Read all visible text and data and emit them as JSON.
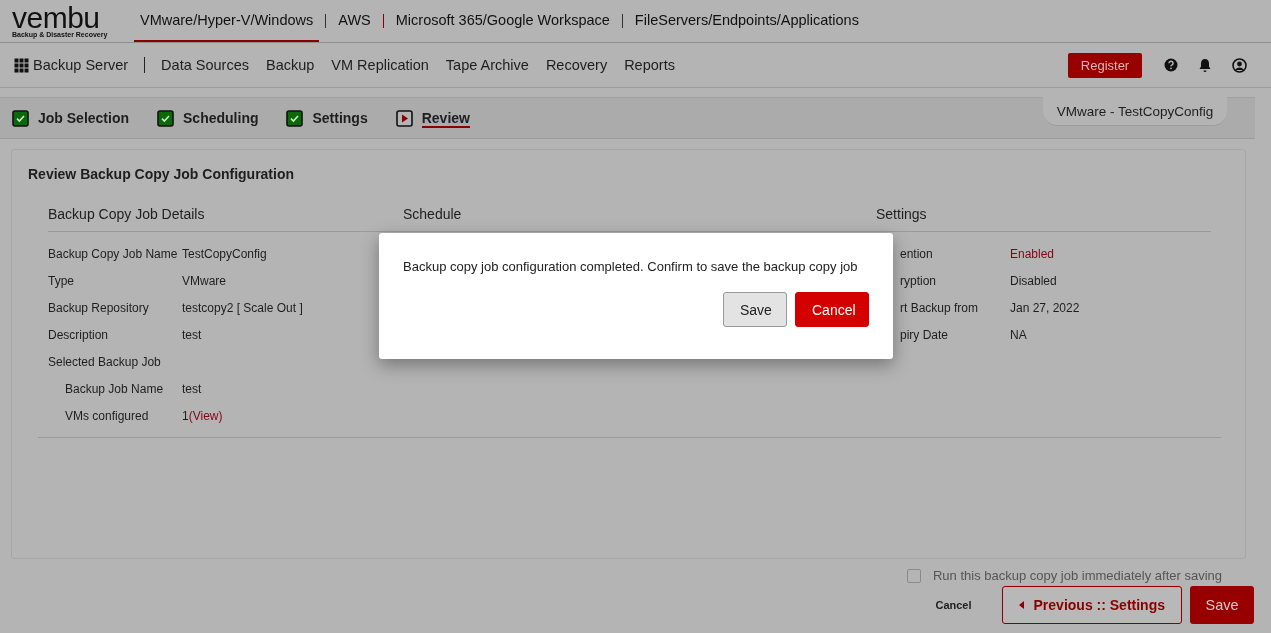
{
  "logo": {
    "name": "vembu",
    "tagline": "Backup & Disaster Recovery"
  },
  "product_tabs": [
    {
      "label": "VMware/Hyper-V/Windows",
      "selected": true
    },
    {
      "label": "AWS",
      "selected": false
    },
    {
      "label": "Microsoft 365/Google Workspace",
      "selected": false
    },
    {
      "label": "FileServers/Endpoints/Applications",
      "selected": false
    }
  ],
  "nav": {
    "home": "Backup Server",
    "items": [
      "Data Sources",
      "Backup",
      "VM Replication",
      "Tape Archive",
      "Recovery",
      "Reports"
    ]
  },
  "register_button": "Register",
  "wizard_steps": [
    {
      "label": "Job Selection",
      "kind": "done",
      "selected": false
    },
    {
      "label": "Scheduling",
      "kind": "done",
      "selected": false
    },
    {
      "label": "Settings",
      "kind": "done",
      "selected": false
    },
    {
      "label": "Review",
      "kind": "current",
      "selected": true
    }
  ],
  "job_title": "VMware - TestCopyConfig",
  "review": {
    "title": "Review Backup Copy Job Configuration",
    "details": {
      "heading": "Backup Copy Job Details",
      "rows": [
        {
          "label": "Backup Copy Job Name",
          "value": "TestCopyConfig"
        },
        {
          "label": "Type",
          "value": "VMware"
        },
        {
          "label": "Backup Repository",
          "value": "testcopy2 [ Scale Out ]"
        },
        {
          "label": "Description",
          "value": "test"
        }
      ],
      "selected_job": {
        "label": "Selected Backup Job",
        "rows": [
          {
            "label": "Backup Job Name",
            "value": "test"
          },
          {
            "label": "VMs configured",
            "value": "1",
            "link": "(View)"
          }
        ]
      }
    },
    "schedule": {
      "heading": "Schedule"
    },
    "settings": {
      "heading": "Settings",
      "rows": [
        {
          "label": "ention",
          "value": "Enabled",
          "highlight": true
        },
        {
          "label": "ryption",
          "value": "Disabled",
          "highlight": false
        },
        {
          "label": "rt Backup from",
          "value": "Jan 27, 2022",
          "highlight": false
        },
        {
          "label": "piry Date",
          "value": "NA",
          "highlight": false
        }
      ]
    }
  },
  "run_immediately": {
    "label": "Run this backup copy job immediately after saving",
    "checked": false
  },
  "footer_buttons": {
    "cancel": "Cancel",
    "previous": "Previous :: Settings",
    "save": "Save"
  },
  "dialog": {
    "message": "Backup copy job configuration completed. Confirm to save the backup copy job",
    "buttons": [
      {
        "label": "Save",
        "kind": "secondary"
      },
      {
        "label": "Cancel",
        "kind": "primary"
      }
    ]
  }
}
